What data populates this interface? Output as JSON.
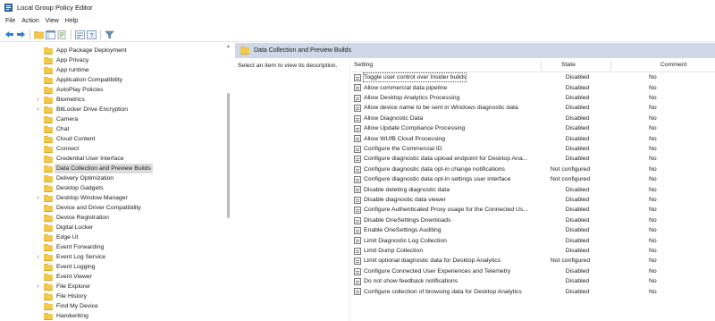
{
  "window": {
    "title": "Local Group Policy Editor"
  },
  "menu": [
    "File",
    "Action",
    "View",
    "Help"
  ],
  "toolbar_icons": [
    "back-arrow-icon",
    "forward-arrow-icon",
    "up-folder-icon",
    "show-hide-tree-icon",
    "export-list-icon",
    "properties-icon",
    "help-icon",
    "filter-icon"
  ],
  "tree": [
    {
      "label": "App Package Deployment",
      "expandable": false
    },
    {
      "label": "App Privacy",
      "expandable": false
    },
    {
      "label": "App runtime",
      "expandable": false
    },
    {
      "label": "Application Compatibility",
      "expandable": false
    },
    {
      "label": "AutoPlay Policies",
      "expandable": false
    },
    {
      "label": "Biometrics",
      "expandable": true
    },
    {
      "label": "BitLocker Drive Encryption",
      "expandable": true
    },
    {
      "label": "Camera",
      "expandable": false
    },
    {
      "label": "Chat",
      "expandable": false
    },
    {
      "label": "Cloud Content",
      "expandable": false
    },
    {
      "label": "Connect",
      "expandable": false
    },
    {
      "label": "Credential User Interface",
      "expandable": false
    },
    {
      "label": "Data Collection and Preview Builds",
      "expandable": false,
      "selected": true
    },
    {
      "label": "Delivery Optimization",
      "expandable": false
    },
    {
      "label": "Desktop Gadgets",
      "expandable": false
    },
    {
      "label": "Desktop Window Manager",
      "expandable": true
    },
    {
      "label": "Device and Driver Compatibility",
      "expandable": false
    },
    {
      "label": "Device Registration",
      "expandable": false
    },
    {
      "label": "Digital Locker",
      "expandable": false
    },
    {
      "label": "Edge UI",
      "expandable": false
    },
    {
      "label": "Event Forwarding",
      "expandable": false
    },
    {
      "label": "Event Log Service",
      "expandable": true
    },
    {
      "label": "Event Logging",
      "expandable": false
    },
    {
      "label": "Event Viewer",
      "expandable": false
    },
    {
      "label": "File Explorer",
      "expandable": true
    },
    {
      "label": "File History",
      "expandable": false
    },
    {
      "label": "Find My Device",
      "expandable": false
    },
    {
      "label": "Handwriting",
      "expandable": false
    }
  ],
  "details": {
    "header_title": "Data Collection and Preview Builds",
    "description": "Select an item to view its description.",
    "columns": {
      "setting": "Setting",
      "state": "State",
      "comment": "Comment"
    },
    "rows": [
      {
        "setting": "Toggle user control over Insider builds",
        "state": "Disabled",
        "comment": "No",
        "selected": true
      },
      {
        "setting": "Allow commercial data pipeline",
        "state": "Disabled",
        "comment": "No"
      },
      {
        "setting": "Allow Desktop Analytics Processing",
        "state": "Disabled",
        "comment": "No"
      },
      {
        "setting": "Allow device name to be sent in Windows diagnostic data",
        "state": "Disabled",
        "comment": "No"
      },
      {
        "setting": "Allow Diagnostic Data",
        "state": "Disabled",
        "comment": "No"
      },
      {
        "setting": "Allow Update Compliance Processing",
        "state": "Disabled",
        "comment": "No"
      },
      {
        "setting": "Allow WUfB Cloud Processing",
        "state": "Disabled",
        "comment": "No"
      },
      {
        "setting": "Configure the Commercial ID",
        "state": "Disabled",
        "comment": "No"
      },
      {
        "setting": "Configure diagnostic data upload endpoint for Desktop Ana...",
        "state": "Disabled",
        "comment": "No"
      },
      {
        "setting": "Configure diagnostic data opt-in change notifications",
        "state": "Not configured",
        "comment": "No"
      },
      {
        "setting": "Configure diagnostic data opt-in settings user interface",
        "state": "Not configured",
        "comment": "No"
      },
      {
        "setting": "Disable deleting diagnostic data",
        "state": "Disabled",
        "comment": "No"
      },
      {
        "setting": "Disable diagnostic data viewer",
        "state": "Disabled",
        "comment": "No"
      },
      {
        "setting": "Configure Authenticated Proxy usage for the Connected Us...",
        "state": "Disabled",
        "comment": "No"
      },
      {
        "setting": "Disable OneSettings Downloads",
        "state": "Disabled",
        "comment": "No"
      },
      {
        "setting": "Enable OneSettings Auditing",
        "state": "Disabled",
        "comment": "No"
      },
      {
        "setting": "Limit Diagnostic Log Collection",
        "state": "Disabled",
        "comment": "No"
      },
      {
        "setting": "Limit Dump Collection",
        "state": "Disabled",
        "comment": "No"
      },
      {
        "setting": "Limit optional diagnostic data for Desktop Analytics",
        "state": "Not configured",
        "comment": "No"
      },
      {
        "setting": "Configure Connected User Experiences and Telemetry",
        "state": "Disabled",
        "comment": "No"
      },
      {
        "setting": "Do not show feedback notifications",
        "state": "Disabled",
        "comment": "No"
      },
      {
        "setting": "Configure collection of browsing data for Desktop Analytics",
        "state": "Disabled",
        "comment": "No"
      }
    ]
  }
}
